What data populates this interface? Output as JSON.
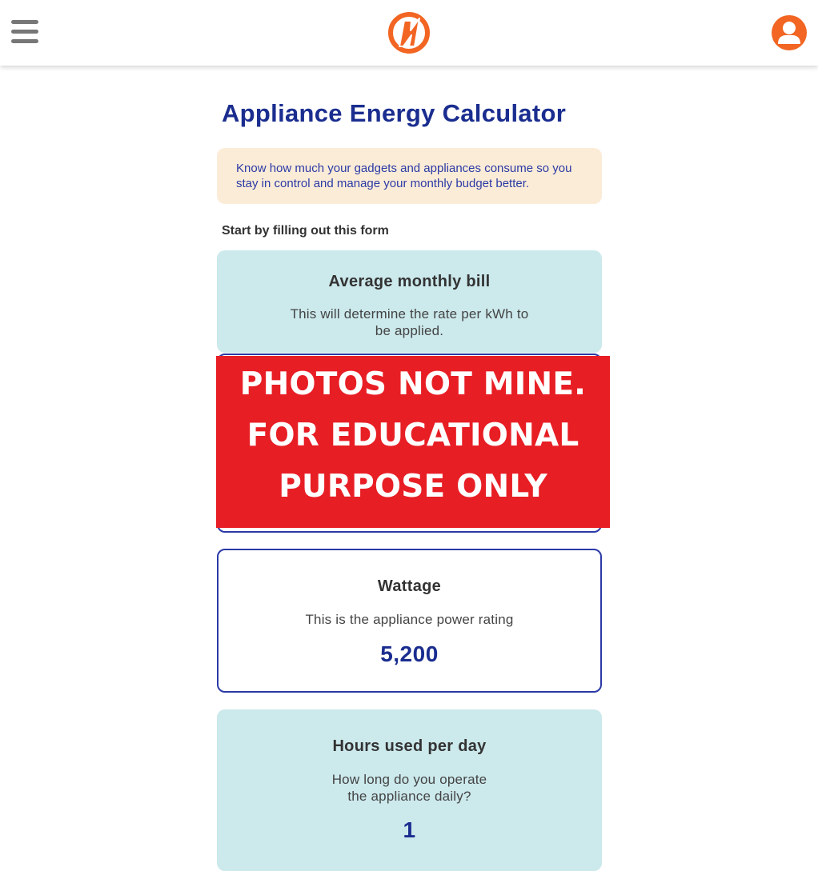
{
  "colors": {
    "brand_orange": "#f26522",
    "title_blue": "#1a2d8f",
    "intro_bg": "#fbecd8",
    "card_bg": "#cce9ec",
    "notice_red": "#e81e25"
  },
  "header": {
    "menu_icon": "hamburger-menu-icon",
    "logo_icon": "lightning-bolt-logo",
    "user_icon": "user-account-icon"
  },
  "page": {
    "title": "Appliance Energy Calculator",
    "intro": "Know how much your gadgets and appliances consume so you stay in control and manage your monthly budget better.",
    "form_lead": "Start by filling out this form"
  },
  "cards": {
    "bill": {
      "title": "Average monthly bill",
      "description": "This will determine the rate per kWh to be applied."
    },
    "wattage": {
      "title": "Wattage",
      "description": "This is the appliance power rating",
      "value": "5,200"
    },
    "hours": {
      "title": "Hours used per day",
      "description": "How long do you operate the appliance daily?",
      "value": "1"
    }
  },
  "notice": {
    "line1": "PHOTOS NOT MINE.",
    "line2": "FOR EDUCATIONAL",
    "line3": "PURPOSE ONLY"
  }
}
